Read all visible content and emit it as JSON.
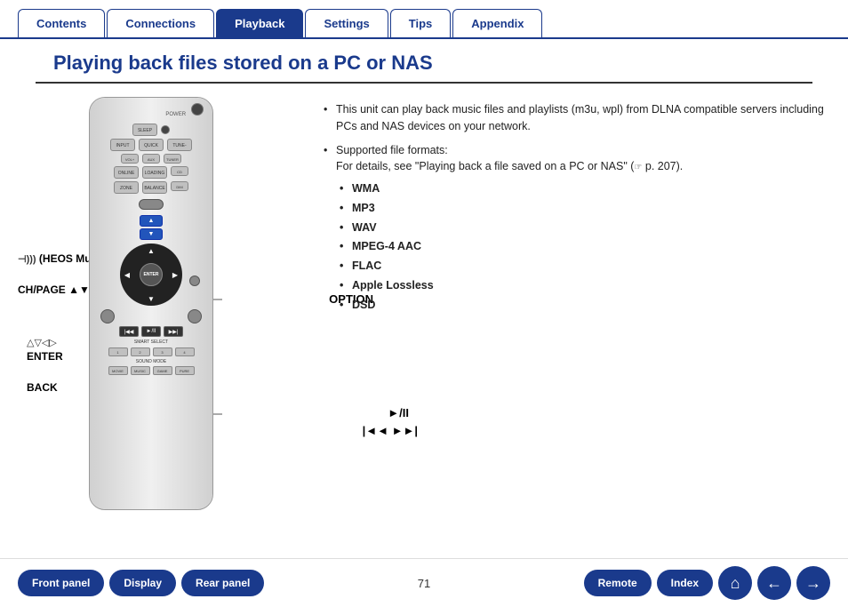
{
  "tabs": [
    {
      "id": "contents",
      "label": "Contents",
      "active": false
    },
    {
      "id": "connections",
      "label": "Connections",
      "active": false
    },
    {
      "id": "playback",
      "label": "Playback",
      "active": true
    },
    {
      "id": "settings",
      "label": "Settings",
      "active": false
    },
    {
      "id": "tips",
      "label": "Tips",
      "active": false
    },
    {
      "id": "appendix",
      "label": "Appendix",
      "active": false
    }
  ],
  "page_title": "Playing back files stored on a PC or NAS",
  "info": {
    "bullet1": "This unit can play back music files and playlists (m3u, wpl) from DLNA compatible servers including PCs and NAS devices on your network.",
    "bullet2_intro": "Supported file formats:",
    "bullet2_detail": "For details, see \"Playing back a file saved on a PC or NAS\" (",
    "bullet2_ref": " p. 207).",
    "formats": [
      "WMA",
      "MP3",
      "WAV",
      "MPEG-4 AAC",
      "FLAC",
      "Apple Lossless",
      "DSD"
    ]
  },
  "remote_labels": {
    "heos": "(HEOS Music)",
    "chpage": "CH/PAGE ▲▼",
    "enter_arrows": "△▽◁▷",
    "enter": "ENTER",
    "back": "BACK",
    "option": "OPTION",
    "playback": "►/II",
    "skip": "|◄◄  ►►|"
  },
  "bottom_nav": {
    "front_panel": "Front panel",
    "display": "Display",
    "rear_panel": "Rear panel",
    "page_number": "71",
    "remote": "Remote",
    "index": "Index",
    "home_icon": "⌂",
    "back_icon": "←",
    "forward_icon": "→"
  }
}
